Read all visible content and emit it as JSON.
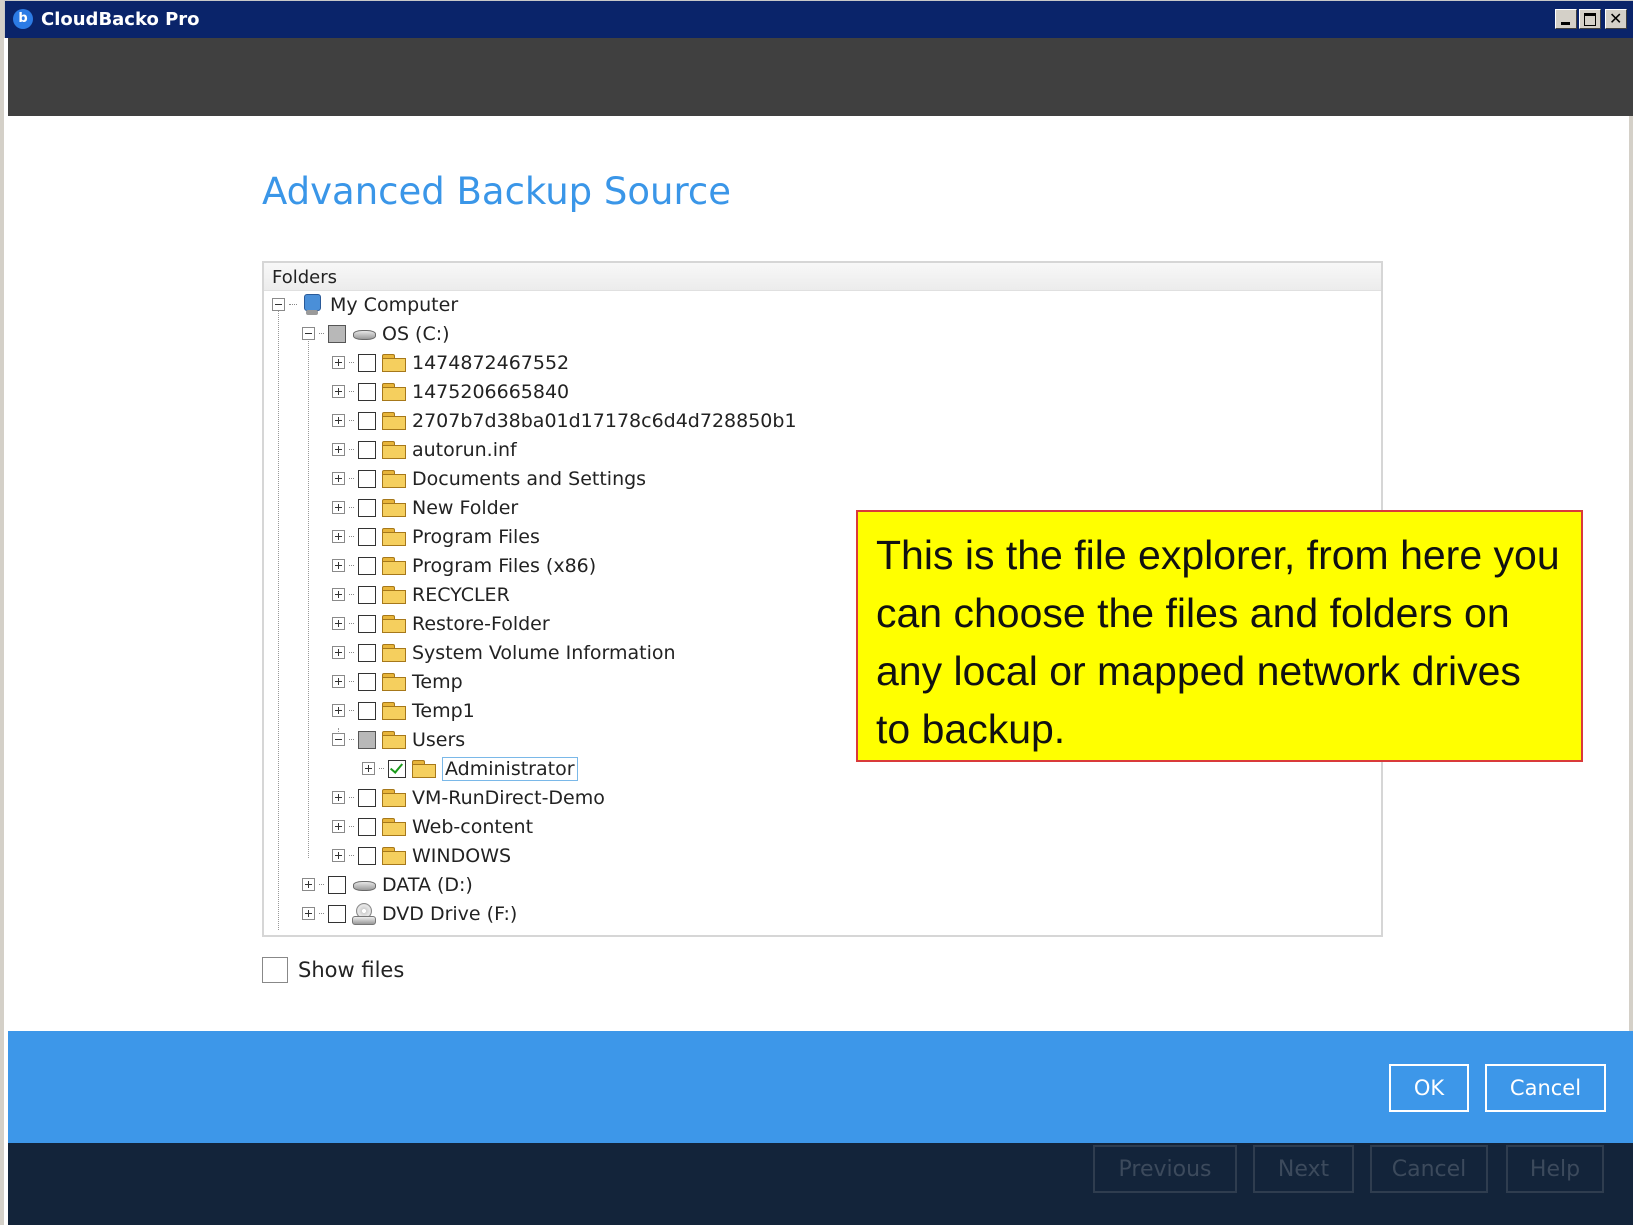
{
  "window": {
    "title": "CloudBacko Pro"
  },
  "page": {
    "title": "Advanced Backup Source"
  },
  "tree": {
    "header": "Folders",
    "root": "My Computer",
    "drive_c": "OS (C:)",
    "folders": [
      {
        "name": "1474872467552",
        "checked": false
      },
      {
        "name": "1475206665840",
        "checked": false
      },
      {
        "name": "2707b7d38ba01d17178c6d4d728850b1",
        "checked": false
      },
      {
        "name": "autorun.inf",
        "checked": false
      },
      {
        "name": "Documents and Settings",
        "checked": false
      },
      {
        "name": "New Folder",
        "checked": false
      },
      {
        "name": "Program Files",
        "checked": false
      },
      {
        "name": "Program Files (x86)",
        "checked": false
      },
      {
        "name": "RECYCLER",
        "checked": false
      },
      {
        "name": "Restore-Folder",
        "checked": false
      },
      {
        "name": "System Volume Information",
        "checked": false
      },
      {
        "name": "Temp",
        "checked": false
      },
      {
        "name": "Temp1",
        "checked": false
      },
      {
        "name": "Users",
        "checked": "partial"
      }
    ],
    "users_child": {
      "name": "Administrator",
      "checked": true
    },
    "folders_after": [
      {
        "name": "VM-RunDirect-Demo",
        "checked": false
      },
      {
        "name": "Web-content",
        "checked": false
      },
      {
        "name": "WINDOWS",
        "checked": false
      }
    ],
    "drive_d": "DATA (D:)",
    "drive_f": "DVD Drive (F:)"
  },
  "options": {
    "show_files_label": "Show files",
    "show_files_checked": false
  },
  "dialog_buttons": {
    "ok": "OK",
    "cancel": "Cancel"
  },
  "nav_buttons": {
    "previous": "Previous",
    "next": "Next",
    "cancel": "Cancel",
    "help": "Help"
  },
  "callout": {
    "text": "This is the file explorer, from here you can choose the files and folders on any local or mapped network drives to backup."
  },
  "icons": {
    "app": "cloudbacko-logo-icon",
    "minimize": "minimize-icon",
    "maximize": "maximize-icon",
    "close": "close-icon",
    "folder": "folder-icon",
    "drive": "hard-drive-icon",
    "dvd": "dvd-drive-icon",
    "computer": "computer-icon",
    "scroll_up": "chevron-up-icon",
    "scroll_down": "chevron-down-icon"
  },
  "colors": {
    "title_accent": "#3a96e8",
    "action_bar": "#3d97e9",
    "nav_bar": "#13243a",
    "header_band": "#404040",
    "callout_fill": "#ffff00",
    "callout_border": "#d93a3a"
  }
}
